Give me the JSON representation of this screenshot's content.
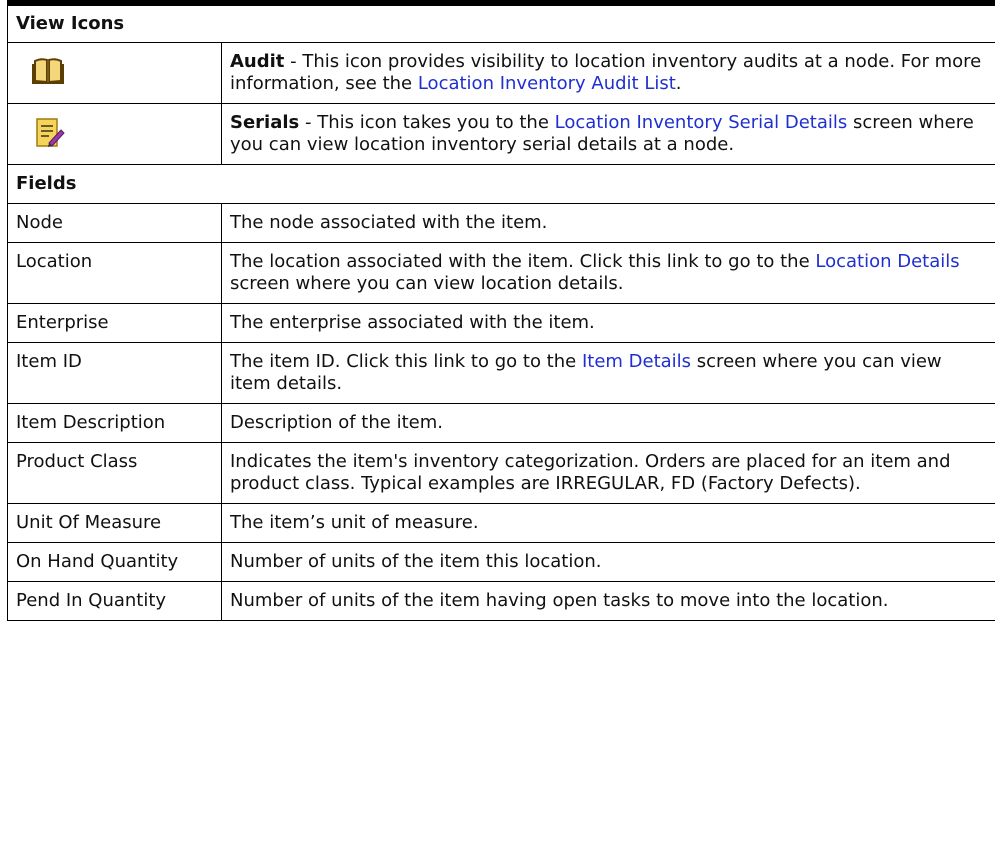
{
  "sections": {
    "view_icons": "View Icons",
    "fields": "Fields"
  },
  "icons": [
    {
      "icon": "open-book-icon",
      "term": "Audit",
      "sep": " - ",
      "text1": "This icon provides visibility to location inventory audits at a node. For more information, see the ",
      "link": "Location Inventory Audit List",
      "text2": "."
    },
    {
      "icon": "notepad-pencil-icon",
      "term": "Serials",
      "sep": " - ",
      "text1": "This icon takes you to the ",
      "link": "Location Inventory Serial Details",
      "text2": " screen where you can view location inventory serial details at a node."
    }
  ],
  "fields": [
    {
      "name": "Node",
      "desc": "The node associated with the item."
    },
    {
      "name": "Location",
      "desc1": "The location associated with the item. Click this link to go to the ",
      "link": "Location Details",
      "desc2": " screen where you can view location details."
    },
    {
      "name": "Enterprise",
      "desc": "The enterprise associated with the item."
    },
    {
      "name": "Item ID",
      "desc1": "The item ID. Click this link to go to the ",
      "link": "Item Details",
      "desc2": " screen where you can view item details."
    },
    {
      "name": "Item Description",
      "desc": "Description of the item."
    },
    {
      "name": "Product Class",
      "desc": "Indicates the item's inventory categorization. Orders are placed for an item and product class. Typical examples are IRREGULAR, FD (Factory Defects)."
    },
    {
      "name": "Unit Of Measure",
      "desc": "The item’s unit of measure."
    },
    {
      "name": "On Hand Quantity",
      "desc": "Number of units of the item this location."
    },
    {
      "name": "Pend In Quantity",
      "desc": "Number of units of the item having open tasks to move into the location."
    }
  ],
  "colors": {
    "link": "#1f2fd0",
    "book_icon": "#7a5a10",
    "notepad_icon": "#e8c24a",
    "pencil_icon": "#9a3aa6"
  }
}
